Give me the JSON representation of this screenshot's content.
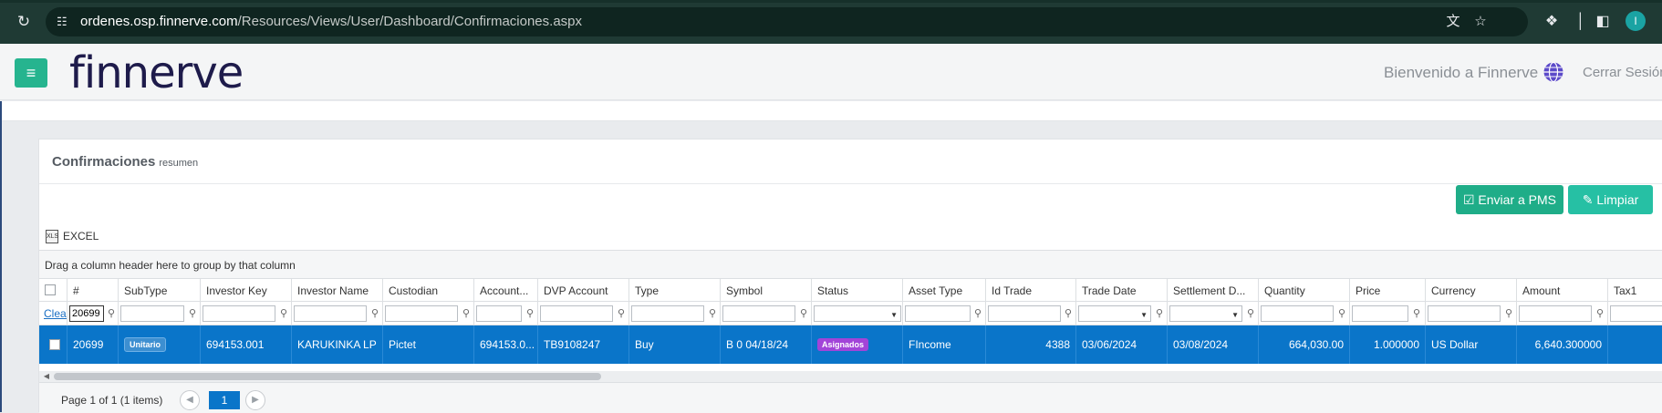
{
  "browser": {
    "url_host": "ordenes.osp.finnerve.com",
    "url_path": "/Resources/Views/User/Dashboard/Confirmaciones.aspx",
    "profile_initial": "I"
  },
  "header": {
    "logo": "finnerve",
    "welcome": "Bienvenido a Finnerve",
    "logout": "Cerrar Sesión"
  },
  "panel": {
    "title": "Confirmaciones",
    "subtitle": "resumen",
    "enviar_label": "Enviar a PMS",
    "limpiar_label": "Limpiar",
    "excel_label": "EXCEL",
    "group_hint": "Drag a column header here to group by that column"
  },
  "grid": {
    "columns": [
      "#",
      "SubType",
      "Investor Key",
      "Investor Name",
      "Custodian",
      "Account...",
      "DVP Account",
      "Type",
      "Symbol",
      "Status",
      "Asset Type",
      "Id Trade",
      "Trade Date",
      "Settlement D...",
      "Quantity",
      "Price",
      "Currency",
      "Amount",
      "Tax1"
    ],
    "filter_clear": "Clear",
    "filter_number_value": "20699",
    "row": {
      "number": "20699",
      "subtype": "Unitario",
      "investor_key": "694153.001",
      "investor_name": "KARUKINKA LP",
      "custodian": "Pictet",
      "account": "694153.0...",
      "dvp_account": "TB9108247",
      "type": "Buy",
      "symbol": "B 0 04/18/24",
      "status": "Asignados",
      "asset_type": "FIncome",
      "id_trade": "4388",
      "trade_date": "03/06/2024",
      "settlement_date": "03/08/2024",
      "quantity": "664,030.00",
      "price": "1.000000",
      "currency": "US Dollar",
      "amount": "6,640.300000",
      "tax1": ""
    }
  },
  "pager": {
    "summary": "Page 1 of 1 (1 items)",
    "current_page": "1"
  },
  "colors": {
    "accent_green": "#1fad88",
    "selected_row": "#0a75c9",
    "status_badge": "#a244d8"
  }
}
